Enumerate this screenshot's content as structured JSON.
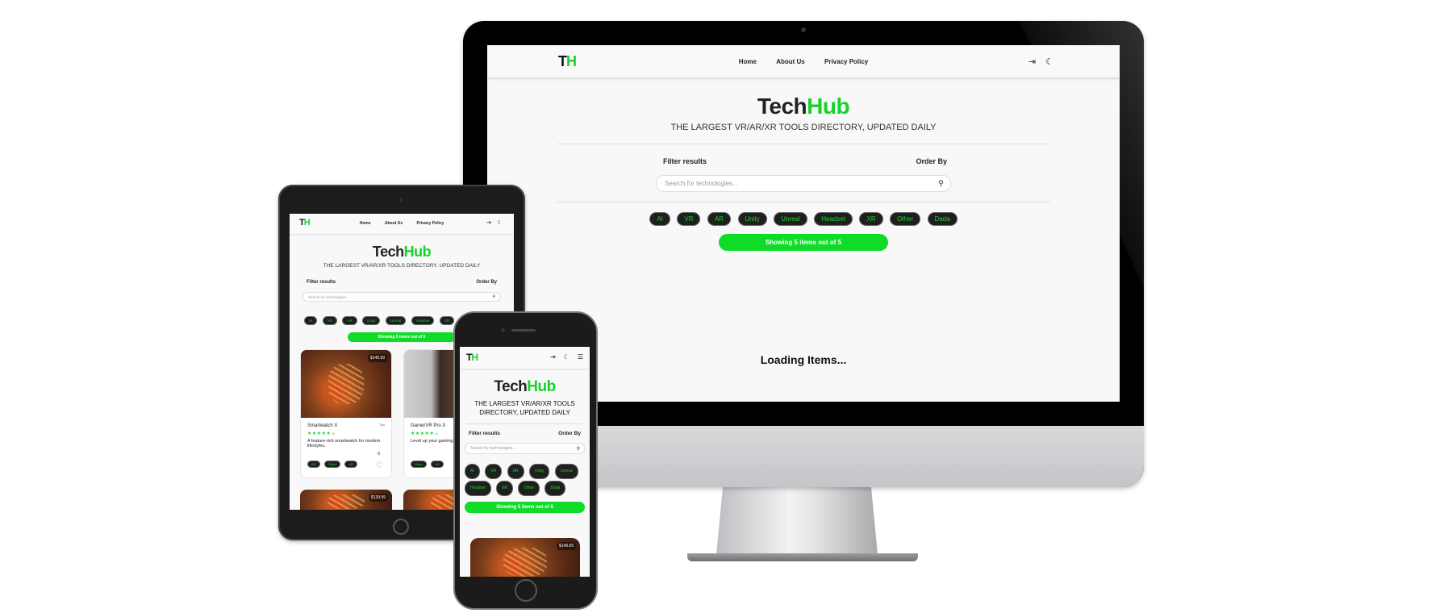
{
  "app": {
    "logo_t": "T",
    "logo_h": "H",
    "brand_first": "Tech",
    "brand_second": "Hub",
    "tagline": "THE LARGEST VR/AR/XR TOOLS DIRECTORY, UPDATED DAILY",
    "nav": {
      "home": "Home",
      "about": "About Us",
      "privacy": "Privacy Policy"
    },
    "icons": {
      "login": "login-icon",
      "theme": "moon-icon",
      "menu": "hamburger-menu-icon",
      "search": "search-icon"
    },
    "filter_label": "Filter results",
    "order_label": "Order By",
    "search_placeholder": "Search for technologies...",
    "chips": [
      "AI",
      "VR",
      "AR",
      "Unity",
      "Unreal",
      "Headset",
      "XR",
      "Other",
      "Dada"
    ],
    "showing": "Showing 5 items out of 5",
    "loading": "Loading Items...",
    "colors": {
      "accent": "#17d22b",
      "chip_bg": "#1f1f1f"
    }
  },
  "cards": [
    {
      "name": "Smartwatch X",
      "type": "Tool",
      "price": "$149.99",
      "rating": "5",
      "description": "A feature-rich smartwatch for modern lifestyles.",
      "likes": "0",
      "tags": [
        "AR",
        "Other",
        "XR"
      ]
    },
    {
      "name": "GamerVR Pro X",
      "type": "",
      "price": "",
      "rating": "4",
      "description": "Level up your gaming experience with",
      "tags": [
        "Other",
        "VR"
      ]
    }
  ],
  "peek_prices": [
    "$139.99",
    "$149.99"
  ]
}
